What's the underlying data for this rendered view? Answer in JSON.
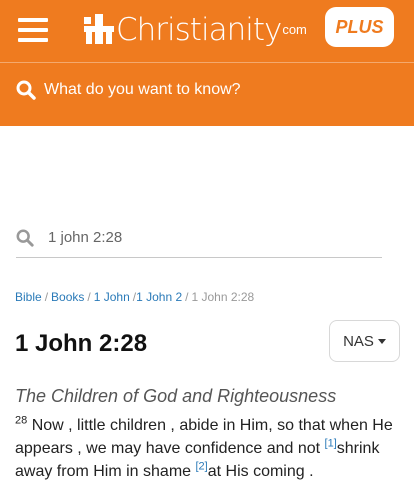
{
  "header": {
    "logo_text": "Christianity",
    "logo_suffix": "com",
    "plus_label": "PLUS",
    "search_placeholder": "What do you want to know?"
  },
  "search": {
    "value": "1 john 2:28"
  },
  "breadcrumb": {
    "items": [
      "Bible",
      "Books",
      "1 John",
      "1 John 2"
    ],
    "current": "1 John 2:28"
  },
  "passage": {
    "title": "1 John 2:28",
    "version": "NAS",
    "section_heading": "The Children of God and Righteousness",
    "verse_number": "28",
    "text_parts": [
      "Now , little children , abide in Him, so that when He appears , we may have confidence and not ",
      "shrink away from Him in shame ",
      "at His coming ."
    ],
    "footnotes": [
      "[1]",
      "[2]"
    ]
  },
  "colors": {
    "brand_orange": "#ef7b1f",
    "link_blue": "#2a7ab8"
  }
}
